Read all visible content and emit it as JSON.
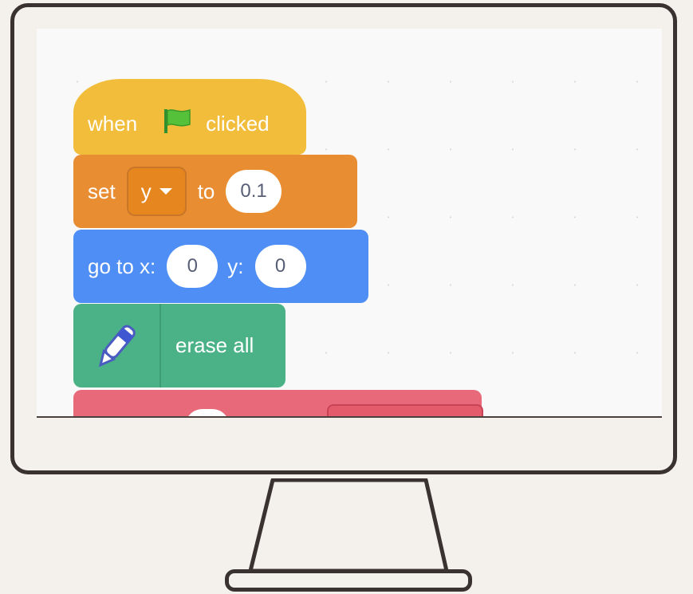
{
  "colors": {
    "events": "#f1bd3a",
    "variables": "#e98d33",
    "motion": "#4f8ef5",
    "pen": "#4bb287",
    "red_block": "#e86a7a",
    "frame": "#3a3230",
    "background": "#f4f1ed"
  },
  "blocks": {
    "hat": {
      "when": "when",
      "flag_icon": "green-flag-icon",
      "clicked": "clicked"
    },
    "set": {
      "label": "set",
      "variable": "y",
      "to": "to",
      "value": "0.1"
    },
    "goto": {
      "label": "go to x:",
      "x": "0",
      "y_label": "y:",
      "y": "0"
    },
    "pen": {
      "icon": "pen-icon",
      "label": "erase all"
    }
  }
}
